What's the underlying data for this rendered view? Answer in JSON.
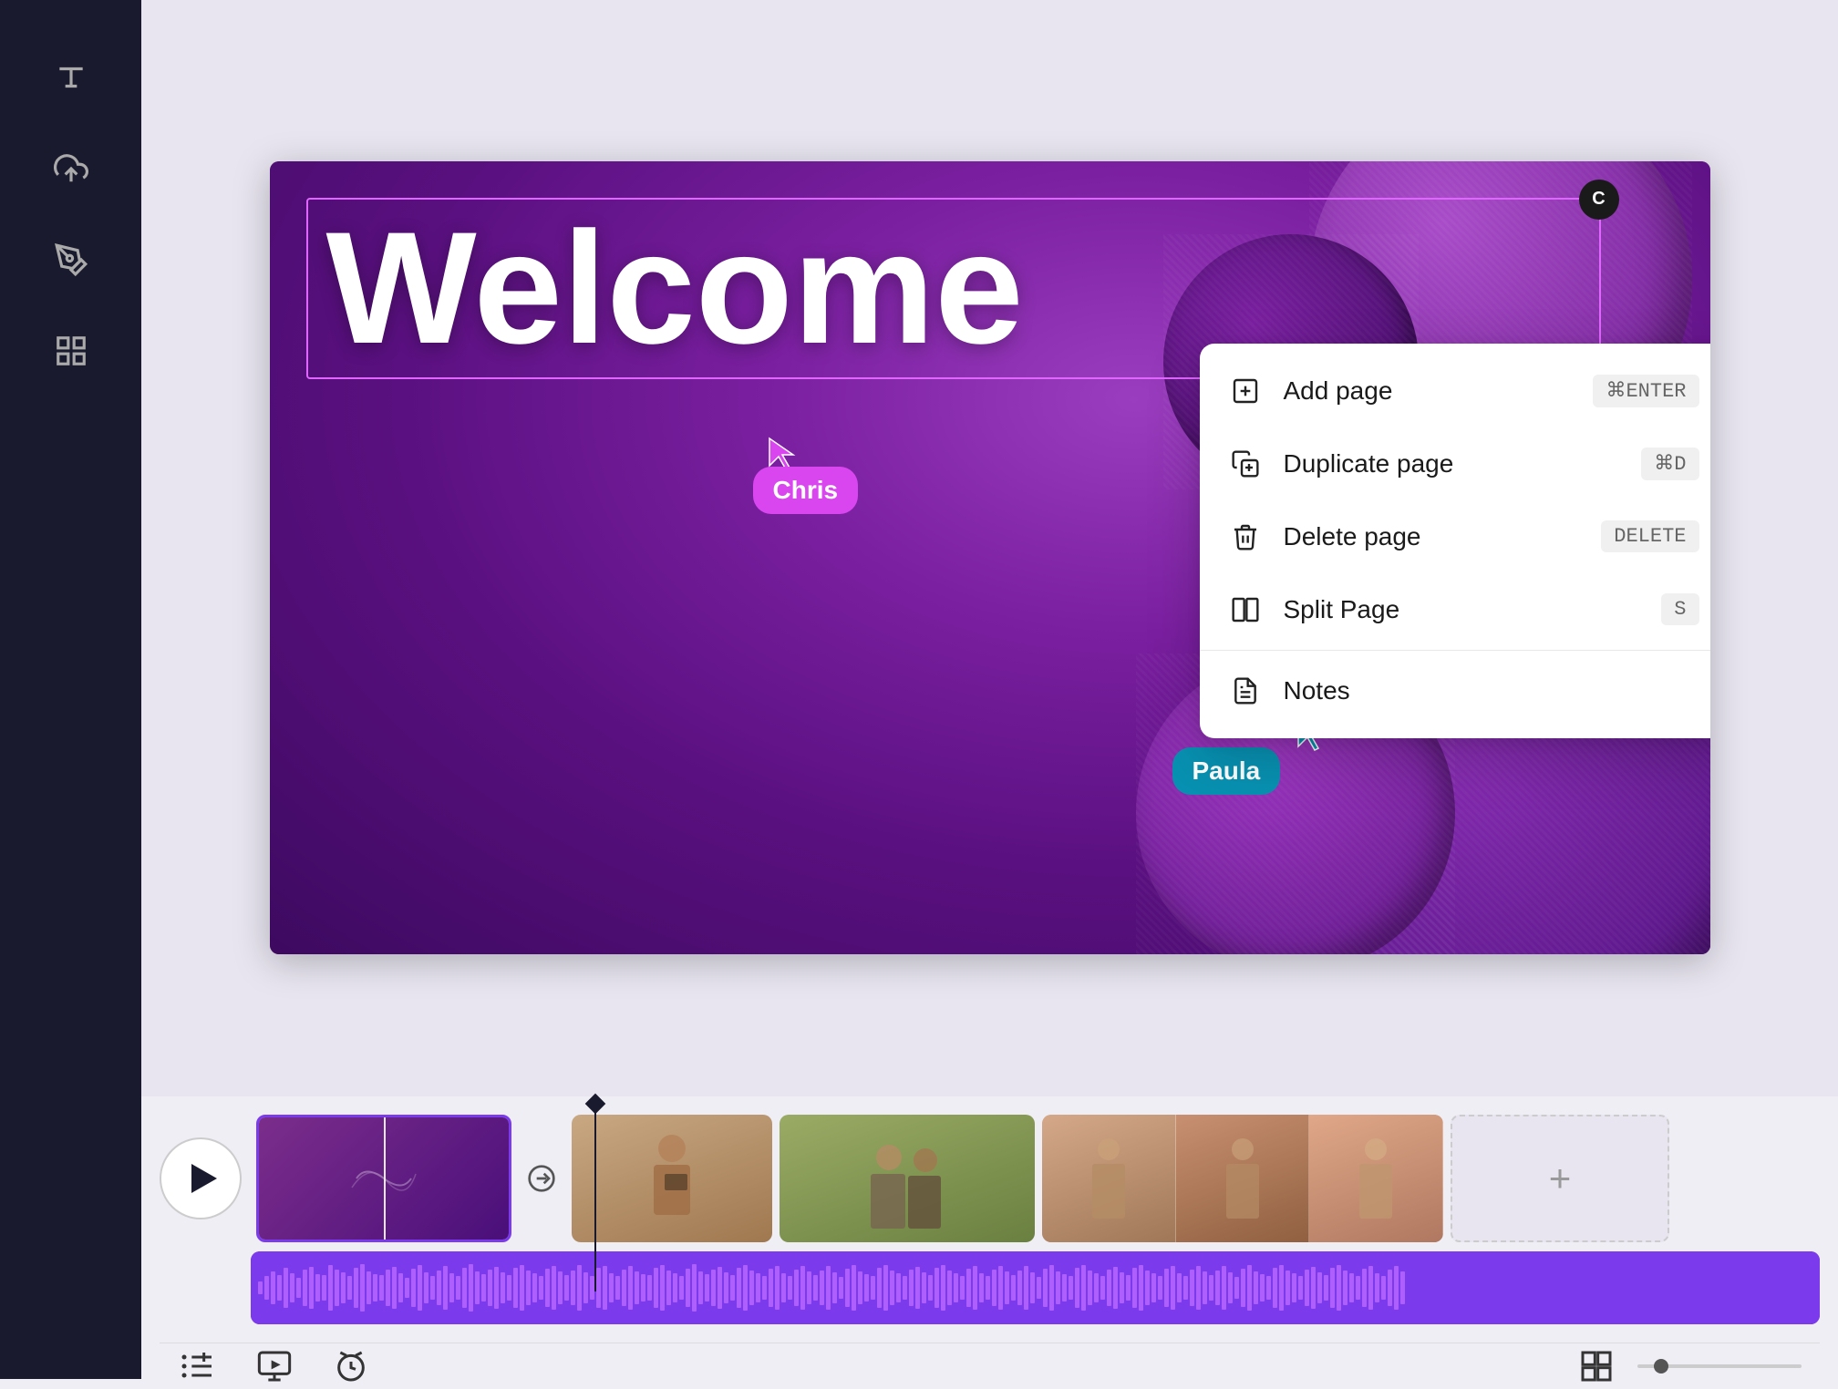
{
  "sidebar": {
    "icons": [
      {
        "name": "text-icon",
        "label": "T"
      },
      {
        "name": "upload-icon",
        "label": "upload"
      },
      {
        "name": "draw-icon",
        "label": "draw"
      },
      {
        "name": "grid-icon",
        "label": "grid"
      }
    ]
  },
  "canvas": {
    "welcome_text": "Welcome",
    "c_avatar_label": "C",
    "collaborators": [
      {
        "name": "Chris",
        "color": "#d946ef",
        "label": "Chris"
      },
      {
        "name": "Paula",
        "color": "#0891b2",
        "label": "Paula"
      }
    ]
  },
  "context_menu": {
    "items": [
      {
        "label": "Add page",
        "shortcut": "⌘ENTER",
        "icon": "add-page-icon"
      },
      {
        "label": "Duplicate page",
        "shortcut": "⌘D",
        "icon": "duplicate-page-icon"
      },
      {
        "label": "Delete page",
        "shortcut": "DELETE",
        "icon": "delete-page-icon"
      },
      {
        "label": "Split Page",
        "shortcut": "S",
        "icon": "split-page-icon"
      },
      {
        "label": "Notes",
        "shortcut": "",
        "icon": "notes-icon"
      }
    ]
  },
  "timeline": {
    "play_button_label": "▶",
    "add_clip_label": "+",
    "clips": [
      {
        "id": "clip-1",
        "type": "video",
        "color": "#5a1fa0"
      },
      {
        "id": "clip-2",
        "type": "video",
        "color": "#c0a080"
      },
      {
        "id": "clip-3",
        "type": "video",
        "color": "#8a9560"
      },
      {
        "id": "clip-4",
        "type": "video",
        "color": "#c09070"
      }
    ]
  },
  "toolbar": {
    "timeline_icon_label": "timeline",
    "preview_icon_label": "preview",
    "timer_icon_label": "timer"
  }
}
